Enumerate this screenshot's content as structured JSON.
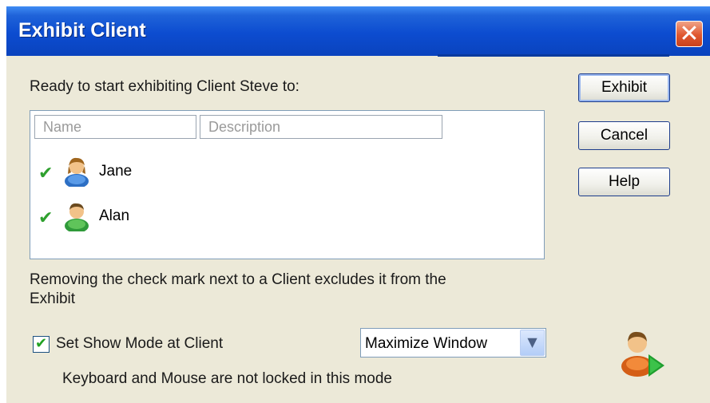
{
  "dialog": {
    "title": "Exhibit Client",
    "close_glyph": "✕",
    "intro": "Ready to start exhibiting Client Steve to:",
    "columns": [
      "Name",
      "Description"
    ],
    "clients": [
      {
        "name": "Jane",
        "checked": true,
        "icon": "female-user-icon"
      },
      {
        "name": "Alan",
        "checked": true,
        "icon": "male-user-icon"
      }
    ],
    "note": [
      "Removing the check mark next to a Client excludes it from the",
      "Exhibit"
    ],
    "show_mode": {
      "label": "Set Show Mode at Client",
      "checked": true,
      "selected": "Maximize Window",
      "hint": "Keyboard and Mouse are not locked in this mode"
    },
    "buttons": {
      "exhibit": "Exhibit",
      "cancel": "Cancel",
      "help": "Help"
    },
    "check_glyph": "✔"
  }
}
